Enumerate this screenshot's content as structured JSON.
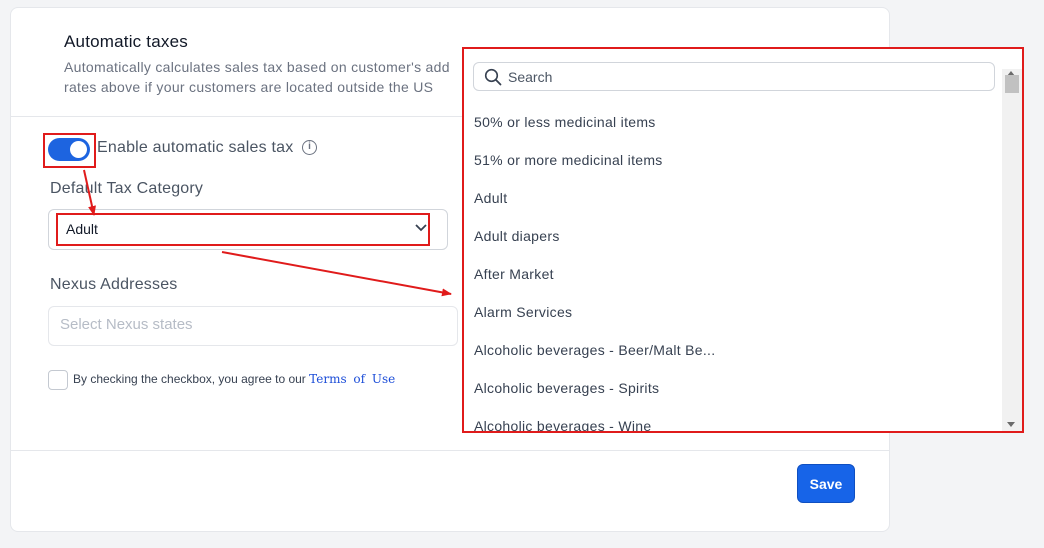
{
  "section": {
    "title": "Automatic taxes",
    "description": "Automatically calculates sales tax based on customer's add\nrates above if your customers are located outside the US"
  },
  "toggle": {
    "label": "Enable automatic sales tax",
    "enabled": true,
    "info_icon": "info-icon"
  },
  "tax_category": {
    "label": "Default Tax Category",
    "value": "Adult"
  },
  "nexus": {
    "label": "Nexus Addresses",
    "placeholder": "Select Nexus states"
  },
  "agreement": {
    "text": "By checking the checkbox, you agree to our",
    "link": "Terms of Use"
  },
  "save_label": "Save",
  "dropdown": {
    "search_placeholder": "Search",
    "options": [
      "50% or less medicinal items",
      "51% or more medicinal items",
      "Adult",
      "Adult diapers",
      "After Market",
      "Alarm Services",
      "Alcoholic beverages - Beer/Malt Be...",
      "Alcoholic beverages - Spirits",
      "Alcoholic beverages - Wine"
    ]
  },
  "colors": {
    "accent": "#1d64e0",
    "annotation": "#e01b1b",
    "link": "#1d4ed8"
  }
}
